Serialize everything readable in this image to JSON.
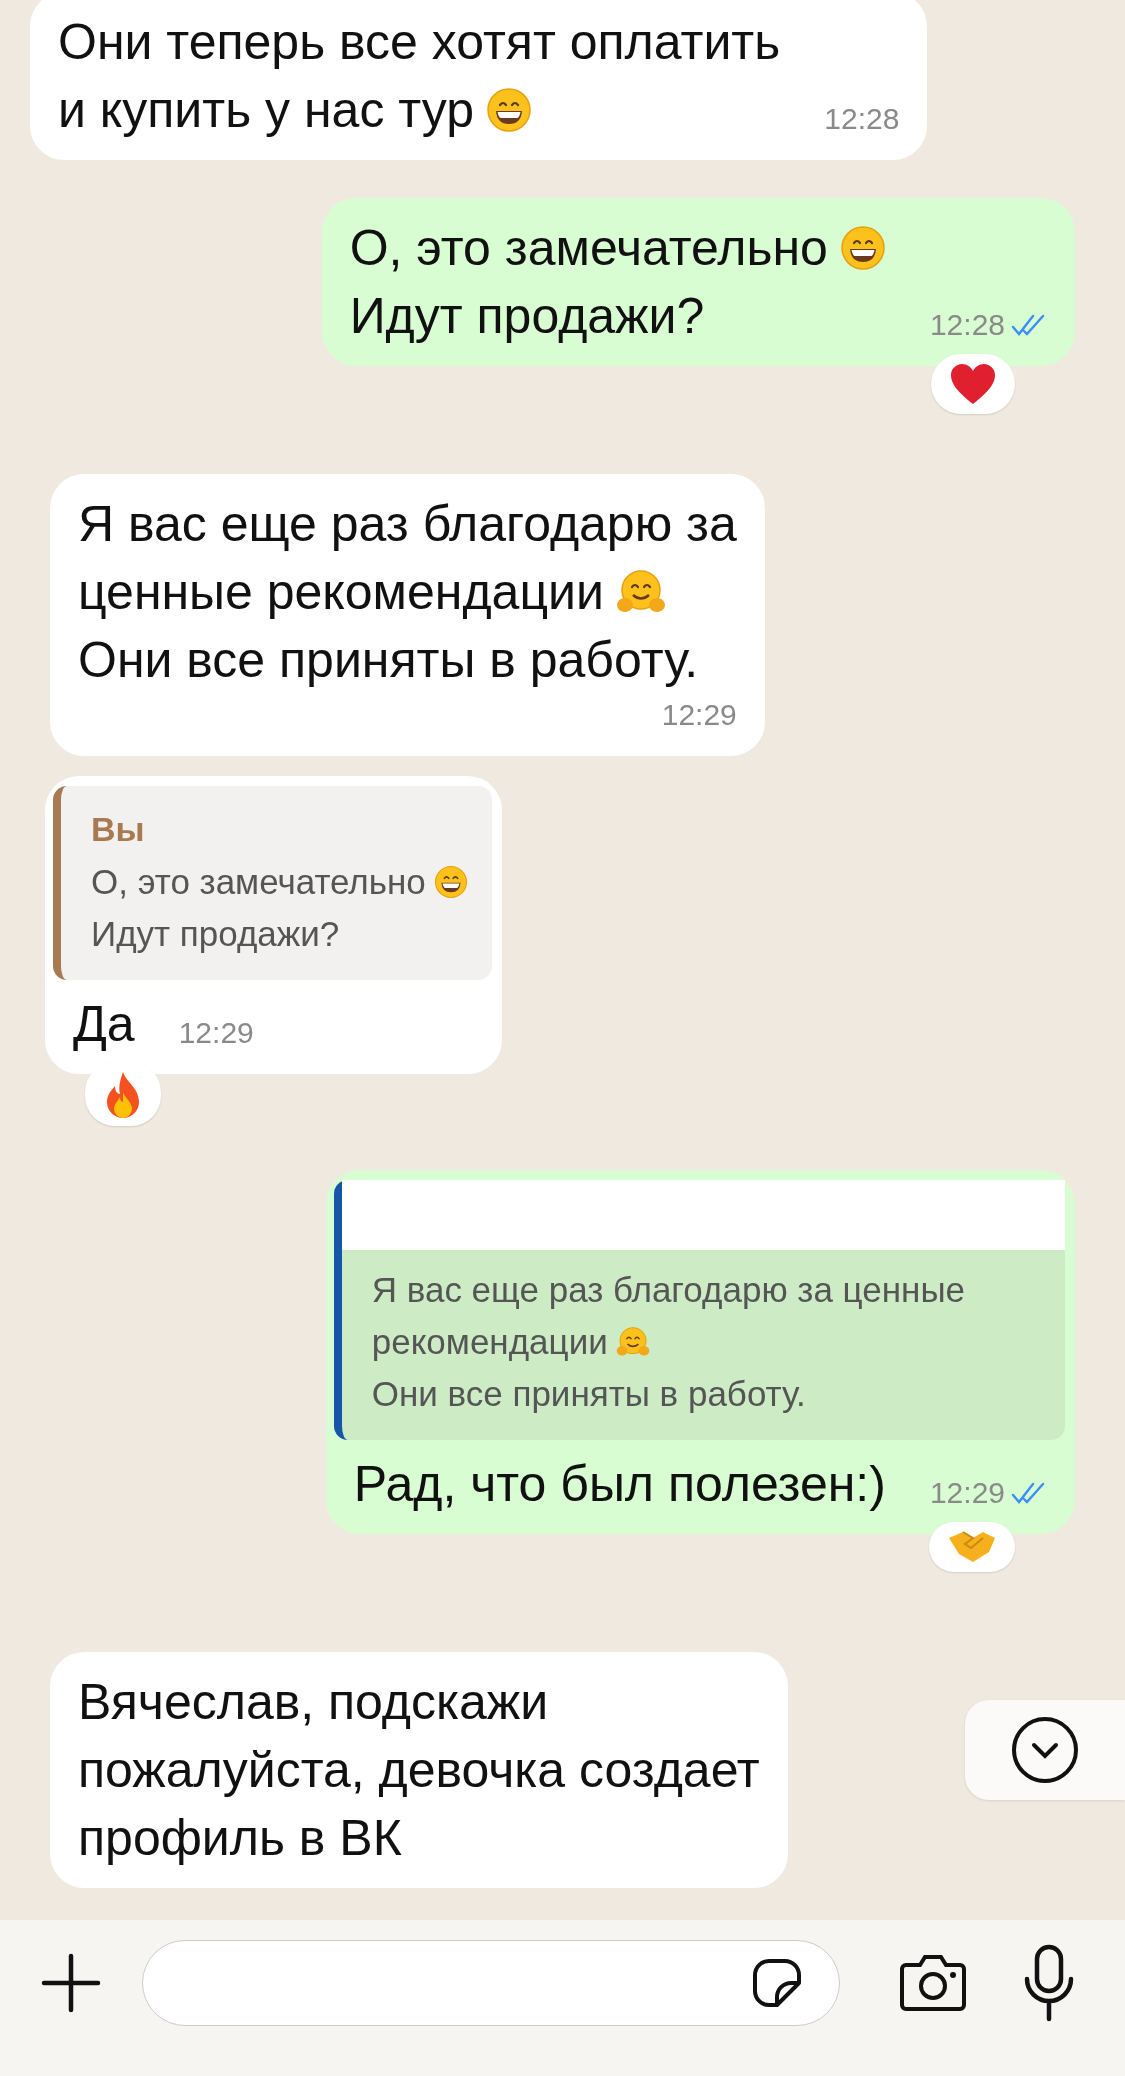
{
  "messages": [
    {
      "kind": "incoming",
      "lines": [
        {
          "text": "Они теперь все хотят оплатить"
        },
        {
          "text": "и купить у нас тур",
          "kind": "grin"
        }
      ],
      "time": "12:28",
      "time_inline": true
    },
    {
      "kind": "outgoing",
      "lines": [
        {
          "text": "О, это замечательно",
          "kind": "grin"
        },
        {
          "text": "Идут продажи?"
        }
      ],
      "time": "12:28",
      "read": true,
      "time_inline": true,
      "reaction": {
        "kind": "heart"
      }
    },
    {
      "kind": "incoming",
      "lines": [
        {
          "text": "Я вас еще раз благодарю за"
        },
        {
          "text": "ценные рекомендации",
          "kind": "hug"
        },
        {
          "text": "Они все приняты в работу."
        }
      ],
      "time": "12:29",
      "time_inline": false
    },
    {
      "kind": "incoming",
      "quote": {
        "author": "Вы",
        "color": "#a87a52",
        "lines": [
          {
            "text": "О, это замечательно",
            "kind": "grin"
          },
          {
            "text": "Идут продажи?"
          }
        ]
      },
      "lines": [
        {
          "text": "Да"
        }
      ],
      "time": "12:29",
      "time_inline": true,
      "reaction": {
        "kind": "fire"
      }
    },
    {
      "kind": "outgoing",
      "quote": {
        "redacted": true,
        "color": "#1656a8",
        "lines": [
          {
            "text": "Я вас еще раз благодарю за ценные"
          },
          {
            "text": "рекомендации",
            "kind": "hug"
          },
          {
            "text": "Они все приняты в работу."
          }
        ]
      },
      "lines": [
        {
          "text": "Рад, что был полезен:)"
        }
      ],
      "time": "12:29",
      "read": true,
      "time_inline": true,
      "reaction": {
        "kind": "handshake"
      }
    },
    {
      "kind": "incoming",
      "lines": [
        {
          "text": "Вячеслав, подскажи"
        },
        {
          "text": "пожалуйста, девочка создает"
        },
        {
          "text": "профиль в ВК"
        }
      ]
    }
  ]
}
